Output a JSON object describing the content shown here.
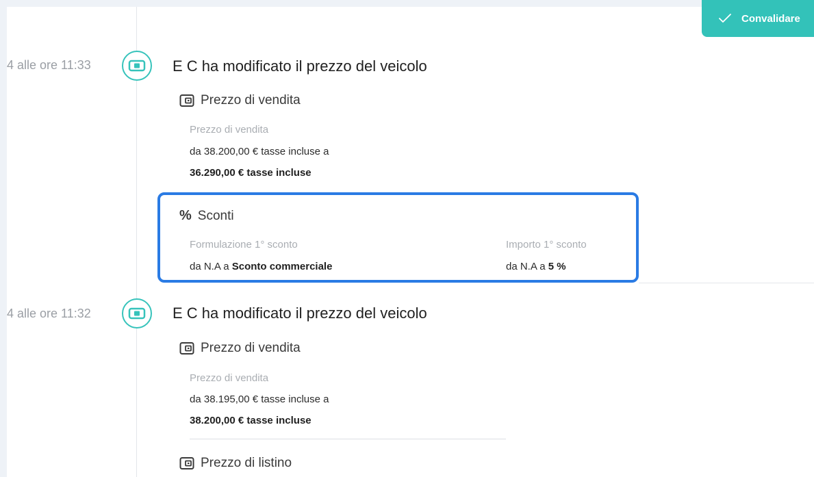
{
  "header": {
    "validate_label": "Convalidare"
  },
  "events": [
    {
      "time": "4 alle ore 11:33",
      "title": "E C ha modificato il prezzo del veicolo",
      "sale_price_section": {
        "title": "Prezzo di vendita",
        "label": "Prezzo di vendita",
        "from_text": "da 38.200,00 €  tasse incluse a",
        "to_text": "36.290,00 €  tasse incluse"
      },
      "discounts": {
        "title": "Sconti",
        "formulation_label": "Formulazione 1° sconto",
        "formulation_prefix": "da N.A a ",
        "formulation_value": "Sconto commerciale",
        "amount_label": "Importo 1° sconto",
        "amount_prefix": "da N.A a ",
        "amount_value": "5  %"
      }
    },
    {
      "time": "4 alle ore 11:32",
      "title": "E C ha modificato il prezzo del veicolo",
      "sale_price_section": {
        "title": "Prezzo di vendita",
        "label": "Prezzo di vendita",
        "from_text": "da 38.195,00 €  tasse incluse a",
        "to_text": "38.200,00 €  tasse incluse"
      },
      "list_price_section": {
        "title": "Prezzo di listino"
      }
    }
  ],
  "colors": {
    "accent": "#33c2b9",
    "highlight": "#2a7be4"
  }
}
